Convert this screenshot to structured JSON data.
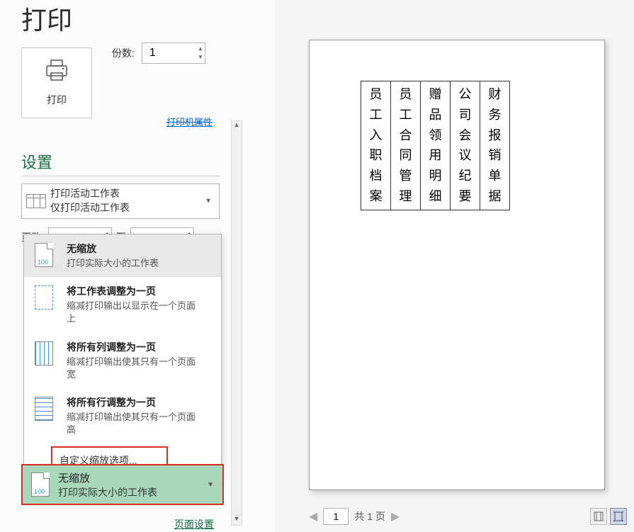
{
  "title": "打印",
  "print_button_label": "打印",
  "copies_label": "份数:",
  "copies_value": "1",
  "printer_properties_link": "打印机属性",
  "settings_header": "设置",
  "print_what": {
    "line1": "打印活动工作表",
    "line2": "仅打印活动工作表"
  },
  "pages_label": "页数:",
  "pages_from": "",
  "pages_to_label": "至",
  "pages_to": "",
  "scale_options": [
    {
      "title": "无缩放",
      "desc": "打印实际大小的工作表"
    },
    {
      "title": "将工作表调整为一页",
      "desc": "缩减打印输出以显示在一个页面上"
    },
    {
      "title": "将所有列调整为一页",
      "desc": "缩减打印输出使其只有一个页面宽"
    },
    {
      "title": "将所有行调整为一页",
      "desc": "缩减打印输出使其只有一个页面高"
    }
  ],
  "custom_scale": "自定义缩放选项...",
  "current_scale": {
    "line1": "无缩放",
    "line2": "打印实际大小的工作表"
  },
  "page_setup_link": "页面设置",
  "preview_table": {
    "cols": [
      "员工入职档案",
      "员工合同管理",
      "赠品领用明细",
      "公司会议纪要",
      "财务报销单据"
    ]
  },
  "page_nav": {
    "current": "1",
    "total_text": "共 1 页"
  }
}
